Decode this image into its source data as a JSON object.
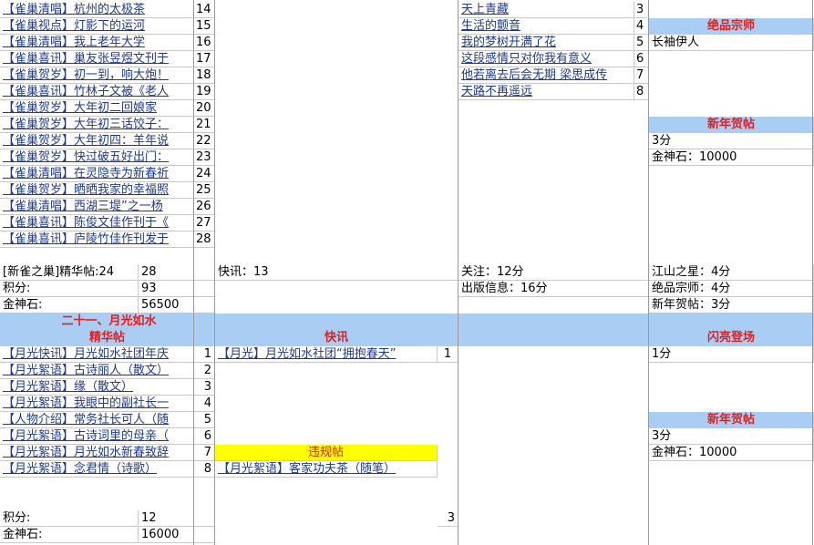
{
  "section1": {
    "posts": [
      {
        "title": "【雀巢清唱】杭州的太极茶",
        "num": "14"
      },
      {
        "title": "【雀巢视点】灯影下的运河",
        "num": "15"
      },
      {
        "title": "【雀巢清唱】我上老年大学",
        "num": "16"
      },
      {
        "title": "【雀巢喜讯】巢友张昱煜文刊于",
        "num": "17"
      },
      {
        "title": "【雀巢贺岁】初一到，响大炮！",
        "num": "18"
      },
      {
        "title": "【雀巢喜讯】竹林子文被《老人",
        "num": "19"
      },
      {
        "title": "【雀巢贺岁】大年初二回娘家",
        "num": "20"
      },
      {
        "title": "【雀巢贺岁】大年初三话饺子：",
        "num": "21"
      },
      {
        "title": "【雀巢贺岁】大年初四：羊年说",
        "num": "22"
      },
      {
        "title": "【雀巢贺岁】快过破五好出门：",
        "num": "23"
      },
      {
        "title": "【雀巢清唱】在灵隐寺为新春祈",
        "num": "24"
      },
      {
        "title": "【雀巢贺岁】晒晒我家的幸福照",
        "num": "25"
      },
      {
        "title": "【雀巢清唱】西湖三堤”之一杨",
        "num": "26"
      },
      {
        "title": "【雀巢喜讯】陈俊文佳作刊于《",
        "num": "27"
      },
      {
        "title": "【雀巢喜讯】庐陵竹佳作刊发于",
        "num": "28"
      }
    ],
    "col3": [
      {
        "title": "天上青藏",
        "num": "3"
      },
      {
        "title": "生活的颤音",
        "num": "4"
      },
      {
        "title": "我的梦树开满了花",
        "num": "5"
      },
      {
        "title": "这段感情只对你我有意义",
        "num": "6"
      },
      {
        "title": "他若离去后会无期 梁思成传",
        "num": "7"
      },
      {
        "title": "天路不再遥远",
        "num": "8"
      }
    ],
    "right": {
      "jueping_header": "绝品宗师",
      "jueping_item": "长袖伊人",
      "xinnian_header": "新年贺帖",
      "xinnian_score": "3分",
      "xinnian_gold": "金神石：10000"
    },
    "summary": {
      "label_jinghua": "[新雀之巢]精华帖:24",
      "jinghua_count": "28",
      "kuaixun": "快讯：13",
      "guanzhu": "关注：12分",
      "chuban": "出版信息：16分",
      "jiangshan": "江山之星：4分",
      "jueping": "绝品宗师：4分",
      "xinnian": "新年贺帖：3分",
      "jifen_label": "积分:",
      "jifen_value": "93",
      "gold_label": "金神石:",
      "gold_value": "56500"
    }
  },
  "section2": {
    "title": "二十一、月光如水",
    "headers": {
      "jinghua": "精华帖",
      "kuaixun": "快讯",
      "shanliang": "闪亮登场",
      "xinnian": "新年贺帖",
      "weigui": "违规帖"
    },
    "posts": [
      {
        "title": "【月光快讯】月光如水社团年庆",
        "num": "1"
      },
      {
        "title": "【月光絮语】古诗丽人（散文）",
        "num": "2"
      },
      {
        "title": "【月光絮语】缘（散文）",
        "num": "3"
      },
      {
        "title": "【月光絮语】我眼中的副社长一",
        "num": "4"
      },
      {
        "title": "【人物介绍】常务社长可人（随",
        "num": "5"
      },
      {
        "title": "【月光絮语】古诗词里的母亲（",
        "num": "6"
      },
      {
        "title": "【月光絮语】月光如水新春致辞",
        "num": "7"
      },
      {
        "title": "【月光絮语】念君情（诗歌）",
        "num": "8"
      }
    ],
    "kuaixun_item": {
      "title": "【月光】月光如水社团“拥抱春天”",
      "num": "1"
    },
    "weigui_item": "【月光絮语】客家功夫茶（随笔）",
    "shanliang_score": "1分",
    "xinnian_score": "3分",
    "xinnian_gold": "金神石：10000",
    "jifen_label": "积分:",
    "jifen_value": "12",
    "count_col3": "3",
    "gold_label": "金神石:",
    "gold_value": "16000"
  }
}
